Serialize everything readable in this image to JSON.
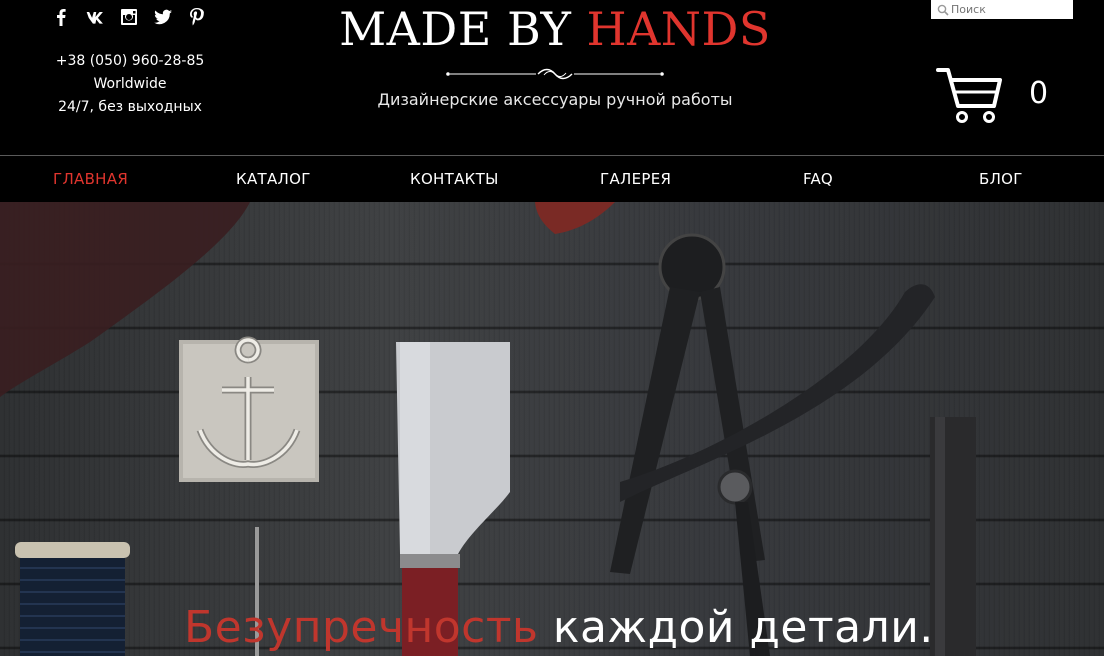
{
  "social": [
    "facebook-icon",
    "vk-icon",
    "instagram-icon",
    "twitter-icon",
    "pinterest-icon"
  ],
  "contact": {
    "phone": "+38 (050) 960-28-85",
    "region": "Worldwide",
    "hours": "24/7, без выходных"
  },
  "logo": {
    "part1": "MADE BY ",
    "part2": "HANDS",
    "tagline": "Дизайнерские аксессуары ручной работы"
  },
  "search": {
    "placeholder": "Поиск"
  },
  "cart": {
    "count": "0"
  },
  "nav": [
    {
      "label": "ГЛАВНАЯ",
      "active": true
    },
    {
      "label": "КАТАЛОГ"
    },
    {
      "label": "КОНТАКТЫ"
    },
    {
      "label": "ГАЛЕРЕЯ"
    },
    {
      "label": "FAQ"
    },
    {
      "label": "БЛОГ"
    }
  ],
  "hero": {
    "headline_red": "Безупречность",
    "headline_white": " каждой детали."
  },
  "colors": {
    "accent": "#e0352e",
    "background": "#000000"
  }
}
